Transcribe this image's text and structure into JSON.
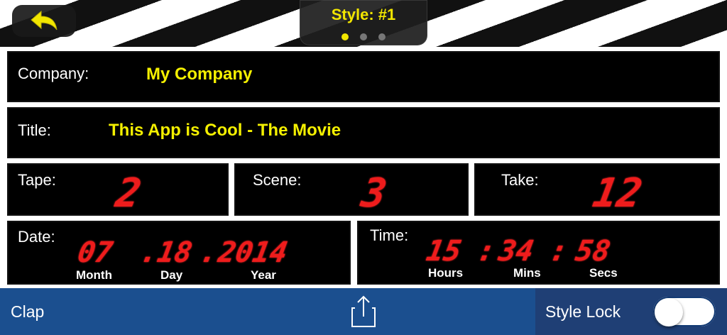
{
  "header": {
    "style_title": "Style: #1",
    "page_count": 3,
    "active_page": 0,
    "accent_color": "#f2e600"
  },
  "slate": {
    "company": {
      "label": "Company:",
      "value": "My Company"
    },
    "title": {
      "label": "Title:",
      "value": "This App is Cool - The Movie"
    },
    "tape": {
      "label": "Tape:",
      "value": "2"
    },
    "scene": {
      "label": "Scene:",
      "value": "3"
    },
    "take": {
      "label": "Take:",
      "value": "12"
    },
    "date": {
      "label": "Date:",
      "month": "07",
      "day": "18",
      "year": "2014",
      "month_label": "Month",
      "day_label": "Day",
      "year_label": "Year"
    },
    "time": {
      "label": "Time:",
      "hours": "15",
      "mins": "34",
      "secs": "58",
      "hours_label": "Hours",
      "mins_label": "Mins",
      "secs_label": "Secs"
    },
    "led_color": "#ee1c1c",
    "text_color": "#f4f000"
  },
  "footer": {
    "clap_label": "Clap",
    "share_icon": "share-icon",
    "style_lock_label": "Style Lock",
    "style_lock_on": false,
    "bar_color": "#1b4f8f"
  }
}
